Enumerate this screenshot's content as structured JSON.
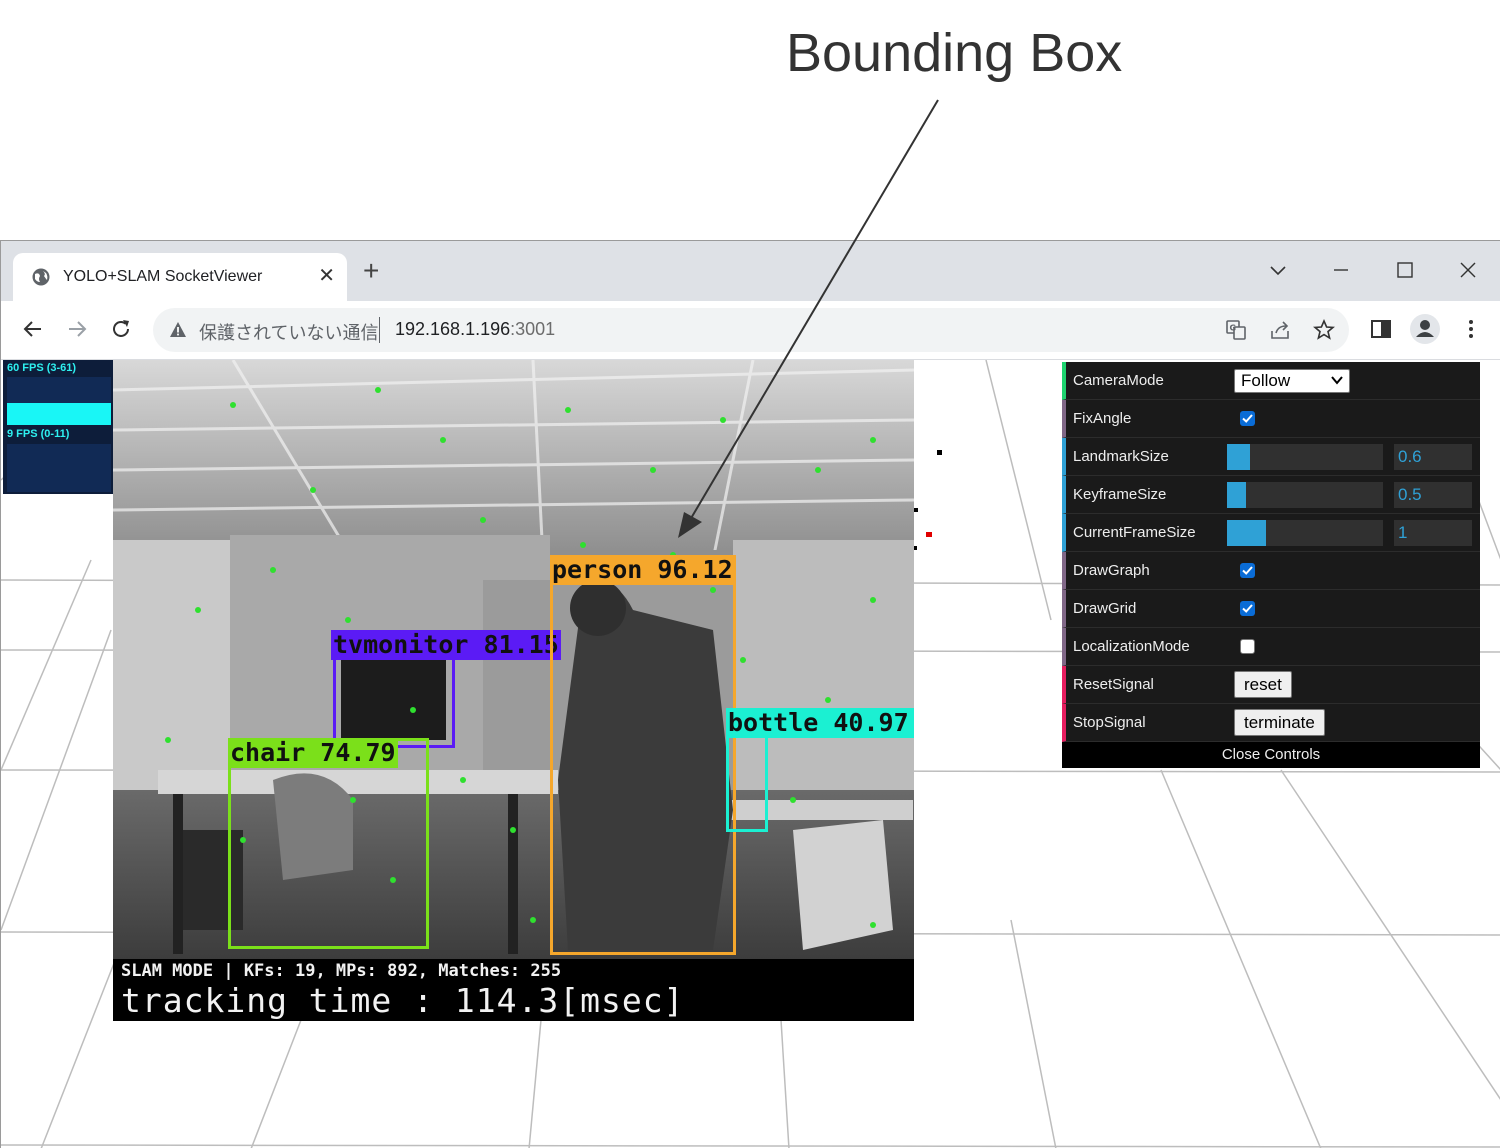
{
  "annotation": {
    "title": "Bounding Box"
  },
  "browser": {
    "tab": {
      "title": "YOLO+SLAM SocketViewer",
      "close": "✕"
    },
    "new_tab": "+",
    "address": {
      "security": "保護されていない通信",
      "host": "192.168.1.196",
      "port": ":3001"
    }
  },
  "stats": {
    "fps_label": "60 FPS (3-61)",
    "ms_label": "9 FPS (0-11)"
  },
  "camera": {
    "detections": [
      {
        "label": "person 96.12",
        "color": "#f5a72c"
      },
      {
        "label": "tvmonitor 81.15",
        "color": "#5b1bf5"
      },
      {
        "label": "chair 74.79",
        "color": "#7be01a"
      },
      {
        "label": "bottle 40.97",
        "color": "#1bf0d2"
      }
    ],
    "status_line": "SLAM MODE |  KFs: 19, MPs: 892, Matches: 255",
    "tracking_line": "tracking time : 114.3[msec]"
  },
  "controls": {
    "camera_mode": {
      "name": "CameraMode",
      "value": "Follow"
    },
    "fix_angle": {
      "name": "FixAngle",
      "checked": true
    },
    "landmark_size": {
      "name": "LandmarkSize",
      "value": "0.6",
      "fraction": 0.15
    },
    "keyframe_size": {
      "name": "KeyframeSize",
      "value": "0.5",
      "fraction": 0.12
    },
    "current_frame_size": {
      "name": "CurrentFrameSize",
      "value": "1",
      "fraction": 0.25
    },
    "draw_graph": {
      "name": "DrawGraph",
      "checked": true
    },
    "draw_grid": {
      "name": "DrawGrid",
      "checked": true
    },
    "localization_mode": {
      "name": "LocalizationMode",
      "checked": false
    },
    "reset_signal": {
      "name": "ResetSignal",
      "button": "reset"
    },
    "stop_signal": {
      "name": "StopSignal",
      "button": "terminate"
    },
    "close": "Close Controls"
  }
}
